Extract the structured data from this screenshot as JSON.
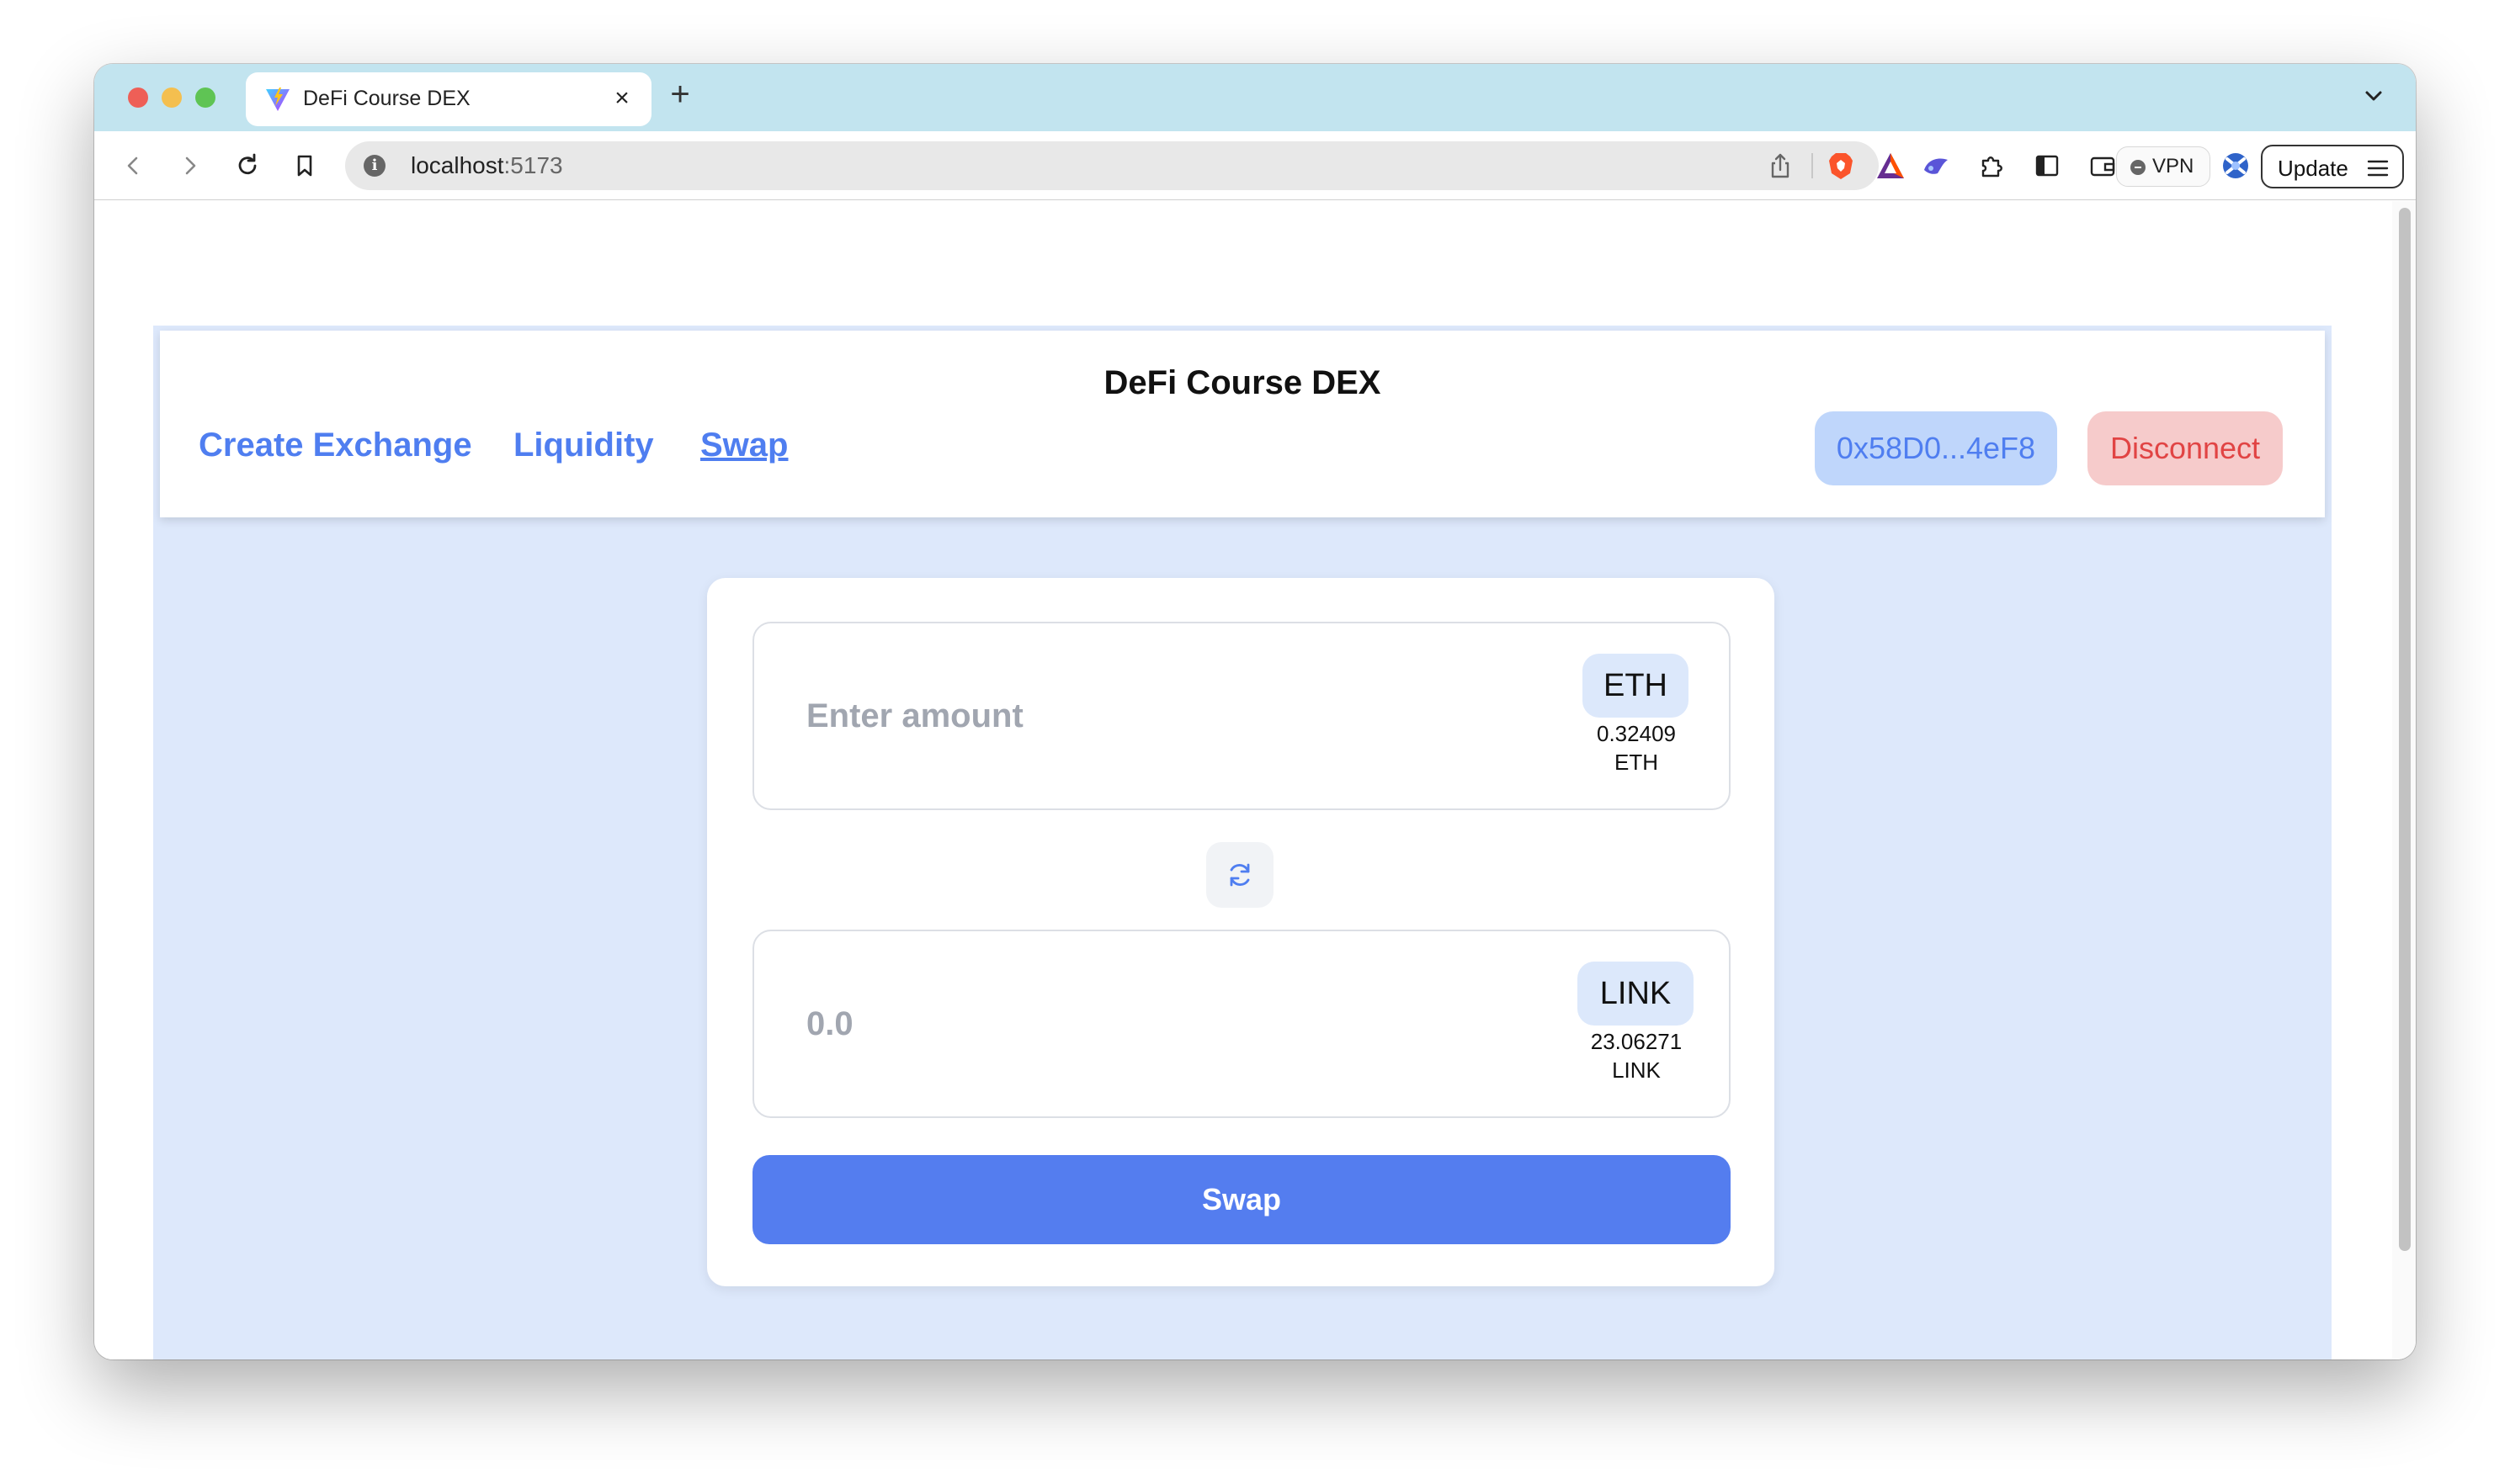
{
  "browser": {
    "tab_title": "DeFi Course DEX",
    "tab_close": "×",
    "new_tab": "+",
    "url_host": "localhost",
    "url_port": ":5173",
    "vpn_label": "VPN",
    "update_label": "Update",
    "icons": [
      "back-icon",
      "forward-icon",
      "reload-icon",
      "bookmark-icon",
      "info-icon",
      "share-icon",
      "brave-shields-icon",
      "brave-rewards-icon",
      "leo-ai-icon",
      "extensions-icon",
      "sidebar-icon",
      "wallet-icon",
      "vpn-icon",
      "profile-icon",
      "menu-icon",
      "tab-list-chevron-icon"
    ]
  },
  "app": {
    "title": "DeFi Course DEX",
    "nav": {
      "create_exchange": "Create Exchange",
      "liquidity": "Liquidity",
      "swap": "Swap"
    },
    "wallet_address": "0x58D0...4eF8",
    "disconnect_label": "Disconnect",
    "colors": {
      "accent": "#547def",
      "background": "#dde8fb",
      "disconnect_text": "#e14444",
      "disconnect_bg": "#f6cbcb"
    }
  },
  "swap": {
    "from": {
      "placeholder": "Enter amount",
      "token": "ETH",
      "balance": "0.32409",
      "balance_symbol": "ETH"
    },
    "to": {
      "placeholder": "0.0",
      "token": "LINK",
      "balance": "23.06271",
      "balance_symbol": "LINK"
    },
    "flip_icon": "swap-direction-icon",
    "button_label": "Swap"
  }
}
